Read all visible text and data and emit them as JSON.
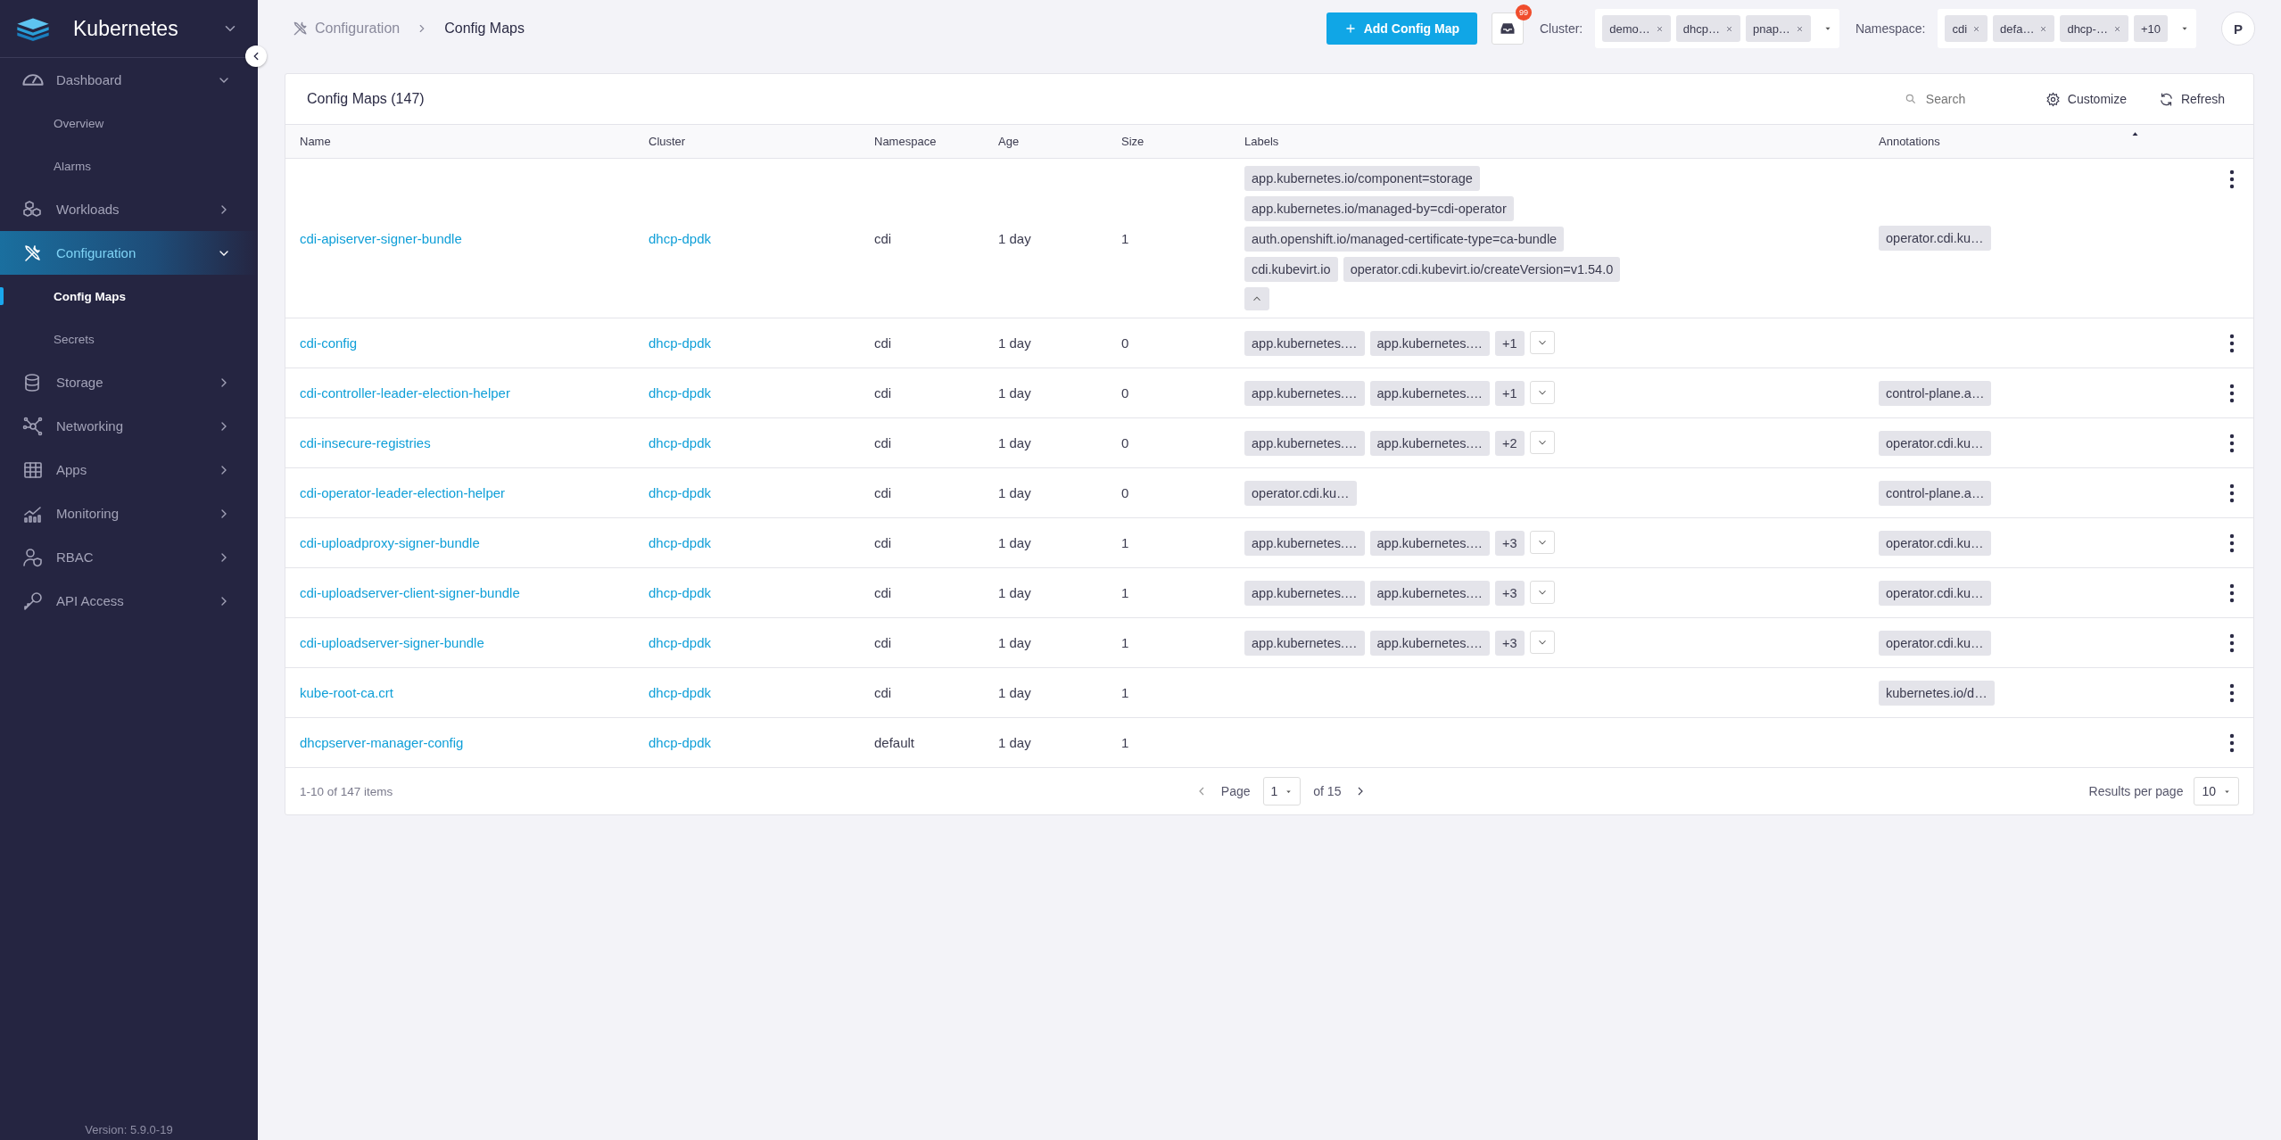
{
  "sidebar": {
    "brand": "Kubernetes",
    "items": [
      {
        "label": "Dashboard",
        "selected": false,
        "expanded": true,
        "children": [
          {
            "label": "Overview",
            "selected": false
          },
          {
            "label": "Alarms",
            "selected": false
          }
        ]
      },
      {
        "label": "Workloads",
        "selected": false,
        "expanded": false
      },
      {
        "label": "Configuration",
        "selected": true,
        "expanded": true,
        "children": [
          {
            "label": "Config Maps",
            "selected": true
          },
          {
            "label": "Secrets",
            "selected": false
          }
        ]
      },
      {
        "label": "Storage",
        "selected": false,
        "expanded": false
      },
      {
        "label": "Networking",
        "selected": false,
        "expanded": false
      },
      {
        "label": "Apps",
        "selected": false,
        "expanded": false
      },
      {
        "label": "Monitoring",
        "selected": false,
        "expanded": false
      },
      {
        "label": "RBAC",
        "selected": false,
        "expanded": false
      },
      {
        "label": "API Access",
        "selected": false,
        "expanded": false
      }
    ],
    "version": "Version: 5.9.0-19"
  },
  "breadcrumb": [
    "Configuration",
    "Config Maps"
  ],
  "topbar": {
    "add_button": "Add Config Map",
    "notifications_count": "99",
    "cluster_filter": {
      "label": "Cluster:",
      "chips": [
        "demo…",
        "dhcp…",
        "pnap…"
      ]
    },
    "namespace_filter": {
      "label": "Namespace:",
      "chips": [
        "cdi",
        "defa…",
        "dhcp-…"
      ],
      "more": "+10"
    },
    "avatar": "P"
  },
  "table": {
    "title": "Config Maps (147)",
    "search": {
      "placeholder": "Search"
    },
    "actions": [
      "Customize",
      "Refresh"
    ],
    "columns": [
      {
        "label": "Name",
        "sorted": false
      },
      {
        "label": "Cluster",
        "sorted": false
      },
      {
        "label": "Namespace",
        "sorted": false
      },
      {
        "label": "Age",
        "sorted": false
      },
      {
        "label": "Size",
        "sorted": false
      },
      {
        "label": "Labels",
        "sorted": false
      },
      {
        "label": "Annotations",
        "sorted": true
      }
    ],
    "rows": [
      {
        "name": "cdi-apiserver-signer-bundle",
        "cluster": "dhcp-dpdk",
        "namespace": "cdi",
        "age": "1 day",
        "size": "1",
        "labels": [
          "app.kubernetes.io/component=storage",
          "app.kubernetes.io/managed-by=cdi-operator",
          "auth.openshift.io/managed-certificate-type=ca-bundle",
          "cdi.kubevirt.io",
          "operator.cdi.kubevirt.io/createVersion=v1.54.0"
        ],
        "expanded": true,
        "annotations": [
          "operator.cdi.ku…"
        ]
      },
      {
        "name": "cdi-config",
        "cluster": "dhcp-dpdk",
        "namespace": "cdi",
        "age": "1 day",
        "size": "0",
        "labels": [
          "app.kubernetes.…",
          "app.kubernetes.…"
        ],
        "more": "+1",
        "expanded": false,
        "annotations": []
      },
      {
        "name": "cdi-controller-leader-election-helper",
        "cluster": "dhcp-dpdk",
        "namespace": "cdi",
        "age": "1 day",
        "size": "0",
        "labels": [
          "app.kubernetes.…",
          "app.kubernetes.…"
        ],
        "more": "+1",
        "expanded": false,
        "annotations": [
          "control-plane.a…"
        ]
      },
      {
        "name": "cdi-insecure-registries",
        "cluster": "dhcp-dpdk",
        "namespace": "cdi",
        "age": "1 day",
        "size": "0",
        "labels": [
          "app.kubernetes.…",
          "app.kubernetes.…"
        ],
        "more": "+2",
        "expanded": false,
        "annotations": [
          "operator.cdi.ku…"
        ]
      },
      {
        "name": "cdi-operator-leader-election-helper",
        "cluster": "dhcp-dpdk",
        "namespace": "cdi",
        "age": "1 day",
        "size": "0",
        "labels": [
          "operator.cdi.ku…"
        ],
        "expanded": false,
        "annotations": [
          "control-plane.a…"
        ]
      },
      {
        "name": "cdi-uploadproxy-signer-bundle",
        "cluster": "dhcp-dpdk",
        "namespace": "cdi",
        "age": "1 day",
        "size": "1",
        "labels": [
          "app.kubernetes.…",
          "app.kubernetes.…"
        ],
        "more": "+3",
        "expanded": false,
        "annotations": [
          "operator.cdi.ku…"
        ]
      },
      {
        "name": "cdi-uploadserver-client-signer-bundle",
        "cluster": "dhcp-dpdk",
        "namespace": "cdi",
        "age": "1 day",
        "size": "1",
        "labels": [
          "app.kubernetes.…",
          "app.kubernetes.…"
        ],
        "more": "+3",
        "expanded": false,
        "annotations": [
          "operator.cdi.ku…"
        ]
      },
      {
        "name": "cdi-uploadserver-signer-bundle",
        "cluster": "dhcp-dpdk",
        "namespace": "cdi",
        "age": "1 day",
        "size": "1",
        "labels": [
          "app.kubernetes.…",
          "app.kubernetes.…"
        ],
        "more": "+3",
        "expanded": false,
        "annotations": [
          "operator.cdi.ku…"
        ]
      },
      {
        "name": "kube-root-ca.crt",
        "cluster": "dhcp-dpdk",
        "namespace": "cdi",
        "age": "1 day",
        "size": "1",
        "labels": [],
        "expanded": false,
        "annotations": [
          "kubernetes.io/d…"
        ]
      },
      {
        "name": "dhcpserver-manager-config",
        "cluster": "dhcp-dpdk",
        "namespace": "default",
        "age": "1 day",
        "size": "1",
        "labels": [],
        "expanded": false,
        "annotations": []
      }
    ],
    "pagination": {
      "range": "1-10 of 147 items",
      "page_label": "Page",
      "page": "1",
      "of": "of 15",
      "per_page_label": "Results per page",
      "per_page": "10"
    }
  }
}
